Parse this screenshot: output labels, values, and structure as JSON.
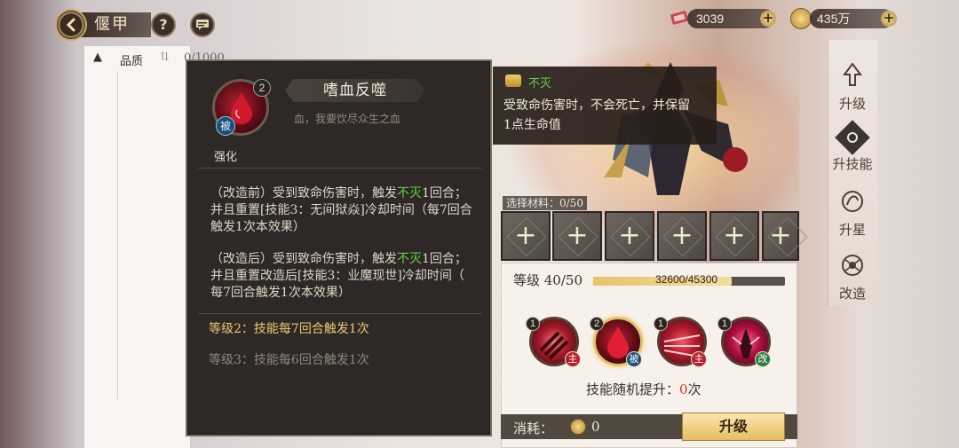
{
  "header": {
    "title": "偃甲",
    "help_icon": "question-icon",
    "chat_icon": "chat-icon"
  },
  "resources": {
    "tickets": "3039",
    "gold": "435万"
  },
  "list": {
    "sort_label": "品质",
    "count": "0/1000"
  },
  "skill_tooltip": {
    "name": "嗜血反噬",
    "flavor": "血，我要饮尽众生之血",
    "level_badge": "2",
    "type_badge": "被",
    "section_label": "强化",
    "before": {
      "prefix": "（改造前）受到致命伤害时，触发",
      "keyword": "不灭",
      "suffix": "1回合；",
      "line2": "并且重置[技能3：无间狱焱]冷却时间（每7回合",
      "line3": "触发1次本效果）"
    },
    "after": {
      "prefix": "（改造后）受到致命伤害时，触发",
      "keyword": "不灭",
      "suffix": "1回合；",
      "line2": "并且重置改造后[技能3：业魔现世]冷却时间（",
      "line3": "每7回合触发1次本效果）"
    },
    "level2": "等级2：技能每7回合触发1次",
    "level3": "等级3：技能每6回合触发1次"
  },
  "buff_tooltip": {
    "name": "不灭",
    "desc_line1": "受致命伤害时，不会死亡，并保留",
    "desc_line2": "1点生命值"
  },
  "materials": {
    "label": "选择材料：0/50",
    "slot_plus": "+"
  },
  "upgrade": {
    "level_label": "等级 40/50",
    "exp_text": "32600/45300",
    "exp_fraction": 0.72,
    "skills": [
      {
        "num": "1",
        "type": "主"
      },
      {
        "num": "2",
        "type": "被"
      },
      {
        "num": "1",
        "type": "主"
      },
      {
        "num": "1",
        "type": "改"
      }
    ],
    "random_label": "技能随机提升：",
    "random_value": "0",
    "random_unit": "次",
    "cost_label": "消耗：",
    "cost_value": "0",
    "button": "升级"
  },
  "side_menu": [
    {
      "label": "升级",
      "icon": "upgrade-icon"
    },
    {
      "label": "升技能",
      "icon": "skill-up-icon"
    },
    {
      "label": "升星",
      "icon": "star-up-icon"
    },
    {
      "label": "改造",
      "icon": "remodel-icon"
    }
  ],
  "colors": {
    "keyword_green": "#5fcf45",
    "red_value": "#d23a2e",
    "panel_dark": "#2e2926",
    "gold": "#e6bd62"
  }
}
